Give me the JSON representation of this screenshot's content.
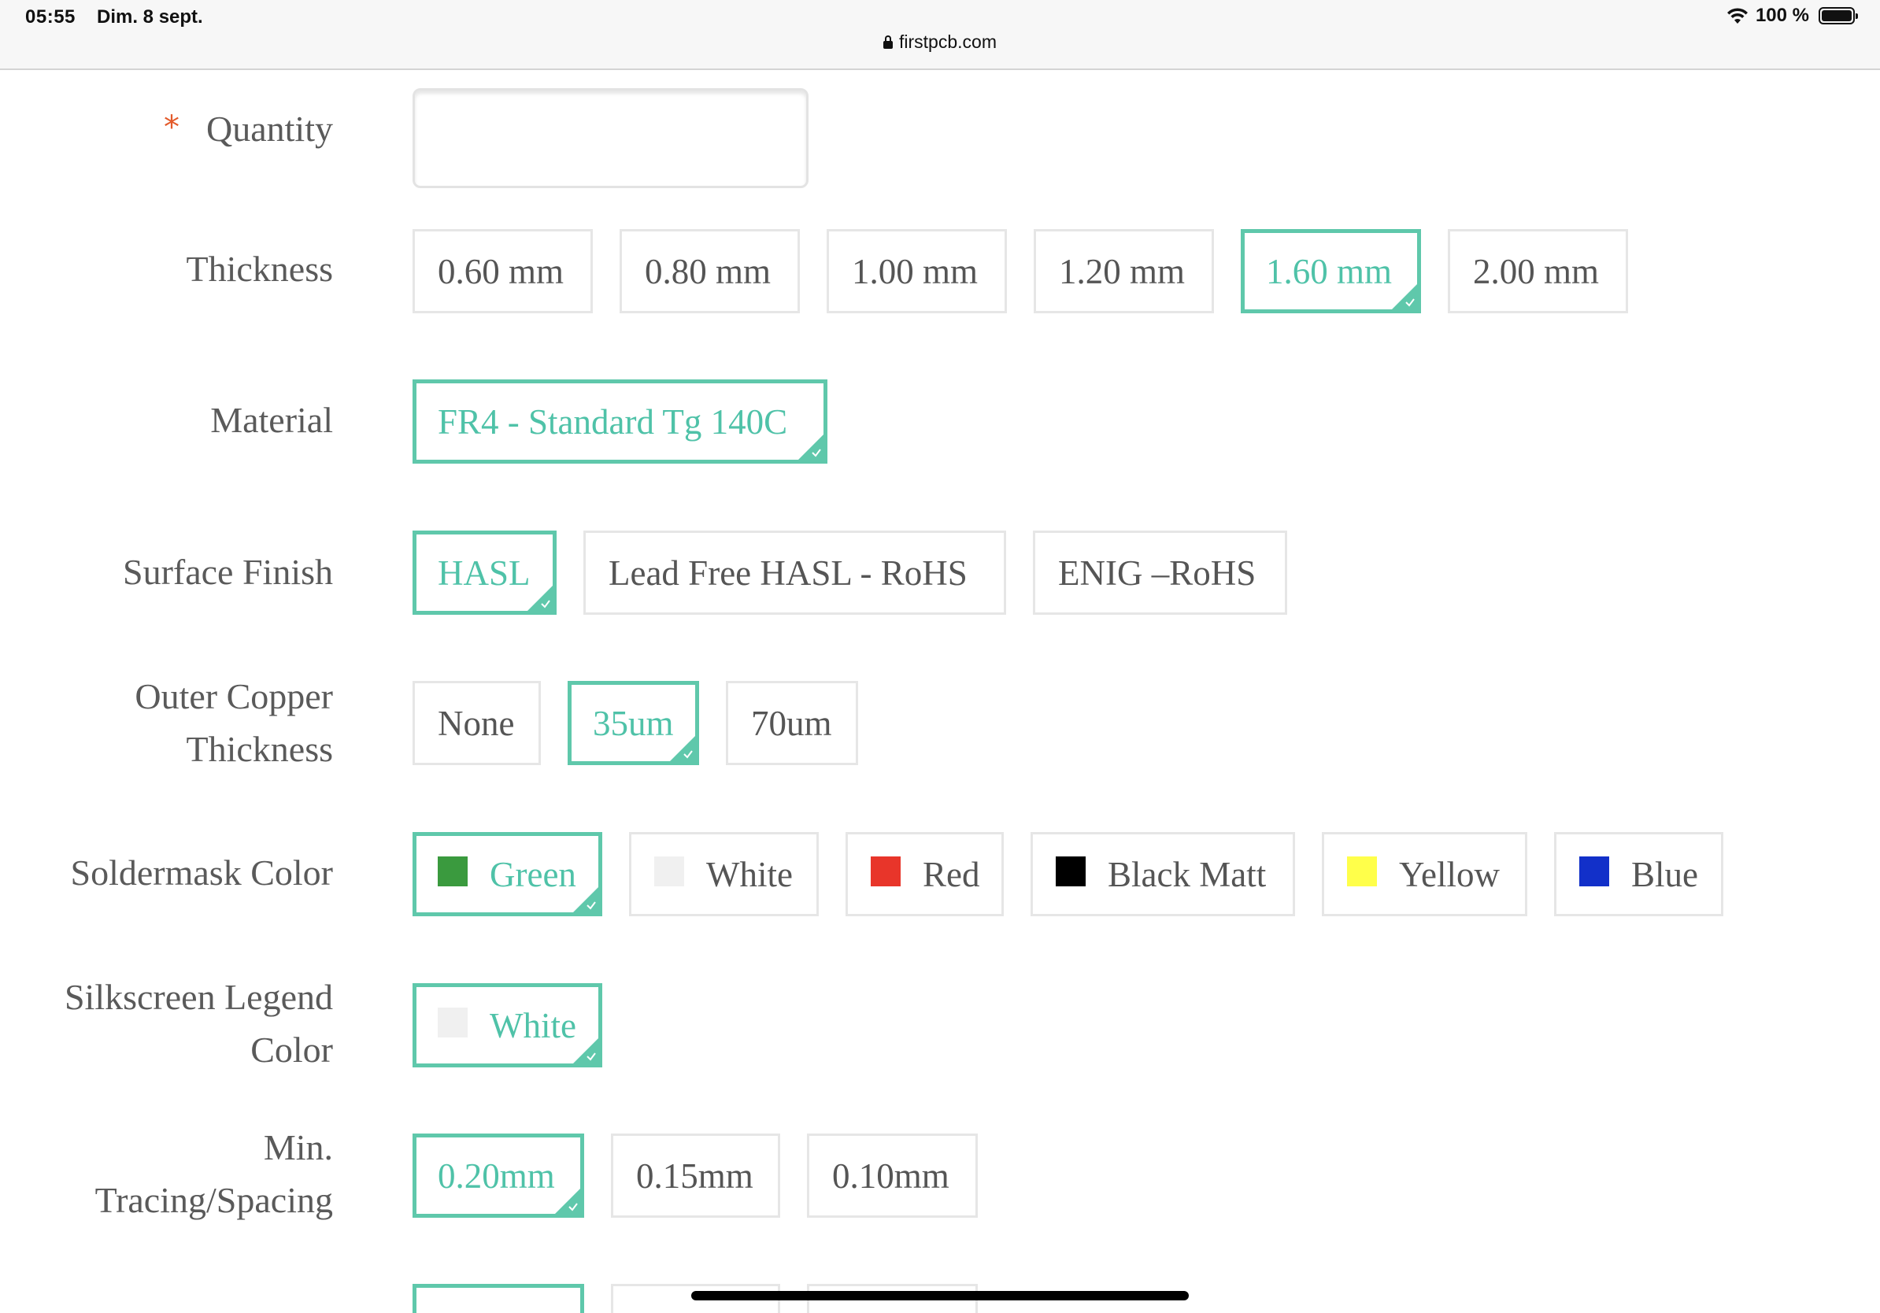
{
  "status_bar": {
    "time": "05:55",
    "date": "Dim. 8 sept.",
    "battery": "100 %",
    "url": "firstpcb.com"
  },
  "accent_color": "#5fc8ab",
  "form": {
    "quantity": {
      "label": "Quantity",
      "required_marker": "*",
      "value": ""
    },
    "thickness": {
      "label": "Thickness",
      "options": [
        "0.60 mm",
        "0.80 mm",
        "1.00 mm",
        "1.20 mm",
        "1.60 mm",
        "2.00 mm"
      ],
      "selected": "1.60 mm"
    },
    "material": {
      "label": "Material",
      "options": [
        "FR4 - Standard Tg 140C"
      ],
      "selected": "FR4 - Standard Tg 140C"
    },
    "surface_finish": {
      "label": "Surface Finish",
      "options": [
        "HASL",
        "Lead Free HASL - RoHS",
        "ENIG –RoHS"
      ],
      "selected": "HASL"
    },
    "outer_copper": {
      "label_line1": "Outer Copper",
      "label_line2": "Thickness",
      "options": [
        "None",
        "35um",
        "70um"
      ],
      "selected": "35um"
    },
    "soldermask": {
      "label": "Soldermask Color",
      "options": [
        {
          "label": "Green",
          "color": "#3a9a3e"
        },
        {
          "label": "White",
          "color": "#f0f0f0"
        },
        {
          "label": "Red",
          "color": "#e8352a"
        },
        {
          "label": "Black Matt",
          "color": "#000000"
        },
        {
          "label": "Yellow",
          "color": "#ffff4a"
        },
        {
          "label": "Blue",
          "color": "#1230c9"
        }
      ],
      "selected": "Green"
    },
    "silkscreen": {
      "label_line1": "Silkscreen Legend",
      "label_line2": "Color",
      "options": [
        {
          "label": "White",
          "color": "#f0f0f0"
        }
      ],
      "selected": "White"
    },
    "min_tracing": {
      "label_line1": "Min.",
      "label_line2": "Tracing/Spacing",
      "options": [
        "0.20mm",
        "0.15mm",
        "0.10mm"
      ],
      "selected": "0.20mm"
    }
  }
}
